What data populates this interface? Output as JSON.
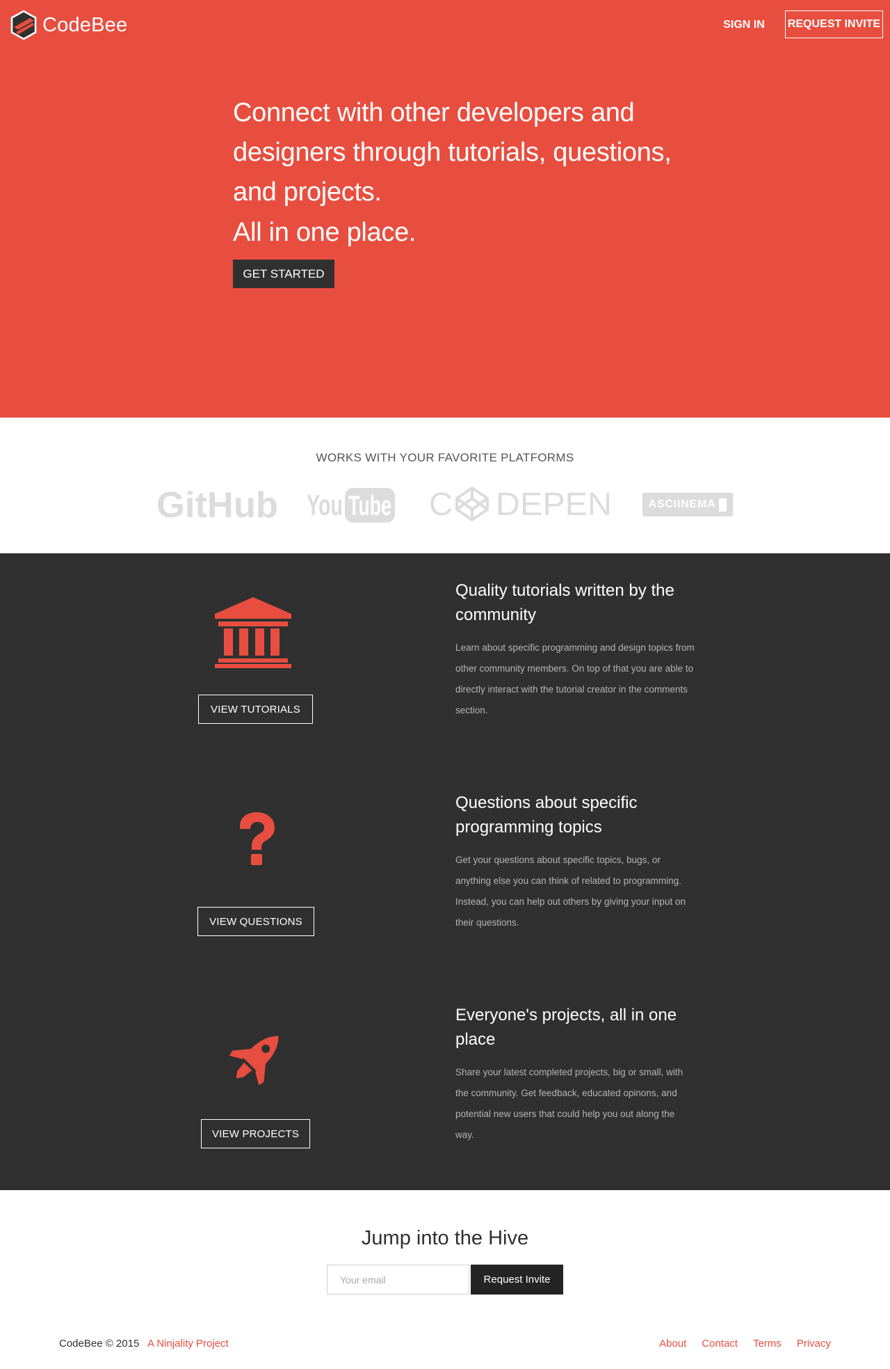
{
  "header": {
    "brand": "CodeBee",
    "sign_in": "SIGN IN",
    "request_invite": "REQUEST INVITE"
  },
  "hero": {
    "headline": "Connect with other developers and designers through tutorials, questions, and projects.",
    "subline": "All in one place.",
    "cta": "GET STARTED"
  },
  "platforms": {
    "title": "WORKS WITH YOUR FAVORITE PLATFORMS",
    "logos": {
      "github": "GitHub",
      "youtube_you": "You",
      "youtube_tube": "Tube",
      "codepen_c": "C",
      "codepen_depen": "DEPEN",
      "asciinema": "ASCIINEMA"
    }
  },
  "features": [
    {
      "icon": "bank-icon",
      "button": "VIEW TUTORIALS",
      "title": "Quality tutorials written by the community",
      "description": "Learn about specific programming and design topics from other community members. On top of that you are able to directly interact with the tutorial creator in the comments section."
    },
    {
      "icon": "question-icon",
      "button": "VIEW QUESTIONS",
      "title": "Questions about specific programming topics",
      "description": "Get your questions about specific topics, bugs, or anything else you can think of related to programming. Instead, you can help out others by giving your input on their questions."
    },
    {
      "icon": "rocket-icon",
      "button": "VIEW PROJECTS",
      "title": "Everyone's projects, all in one place",
      "description": "Share your latest completed projects, big or small, with the community. Get feedback, educated opinons, and potential new users that could help you out along the way."
    }
  ],
  "signup": {
    "title": "Jump into the Hive",
    "email_placeholder": "Your email",
    "button": "Request Invite"
  },
  "footer": {
    "copyright": "CodeBee © 2015",
    "ninjality": "A Ninjality Project",
    "links": [
      "About",
      "Contact",
      "Terms",
      "Privacy"
    ]
  },
  "colors": {
    "brand_red": "#e84e3f",
    "dark": "#303030",
    "logo_gray": "#dcdcdc"
  }
}
